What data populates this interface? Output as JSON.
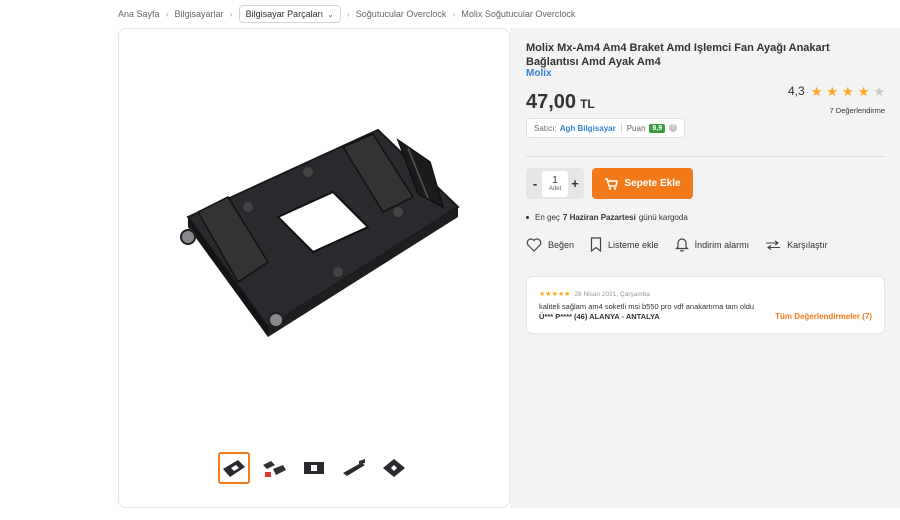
{
  "breadcrumb": {
    "items": [
      "Ana Sayfa",
      "Bilgisayarlar",
      "Bilgisayar Parçaları",
      "Soğutucular Overclock",
      "Molix Soğutucular Overclock"
    ]
  },
  "product": {
    "title": "Molix Mx-Am4 Am4 Braket Amd Işlemci Fan Ayağı Anakart Bağlantısı Amd Ayak Am4",
    "brand": "Molix",
    "price": "47,00",
    "currency": "TL",
    "rating_score": "4,3",
    "rating_value": 4.3,
    "rating_max": 5,
    "review_count_text": "7 Değerlendirme"
  },
  "seller": {
    "label": "Satıcı:",
    "name": "Agh Bilgisayar",
    "points_label": "Puan",
    "points": "9,9",
    "help": "?"
  },
  "quantity": {
    "minus": "-",
    "value": "1",
    "unit": "Adet",
    "plus": "+"
  },
  "add_to_cart_label": "Sepete Ekle",
  "shipping": {
    "prefix": "En geç",
    "date": "7 Haziran Pazartesi",
    "suffix": "günü kargoda"
  },
  "actions": {
    "like": "Beğen",
    "add_list": "Listeme ekle",
    "price_alert": "İndirim alarmı",
    "compare": "Karşılaştır"
  },
  "review": {
    "date": "28 Nisan 2021, Çarşamba",
    "text": "kaliteli sağlam am4 soketli msi b550 pro vdf anakartıma tam oldu",
    "author": "Ü*** P**** (46) ALANYA - ANTALYA",
    "all_reviews": "Tüm Değerlendirmeler (7)",
    "stars": 5
  },
  "gallery": {
    "thumbnail_count": 5,
    "active_index": 0
  },
  "colors": {
    "accent": "#f27a1a",
    "link": "#3a82d6",
    "star": "#ffa41b",
    "badge_green": "#3a9c3a"
  }
}
